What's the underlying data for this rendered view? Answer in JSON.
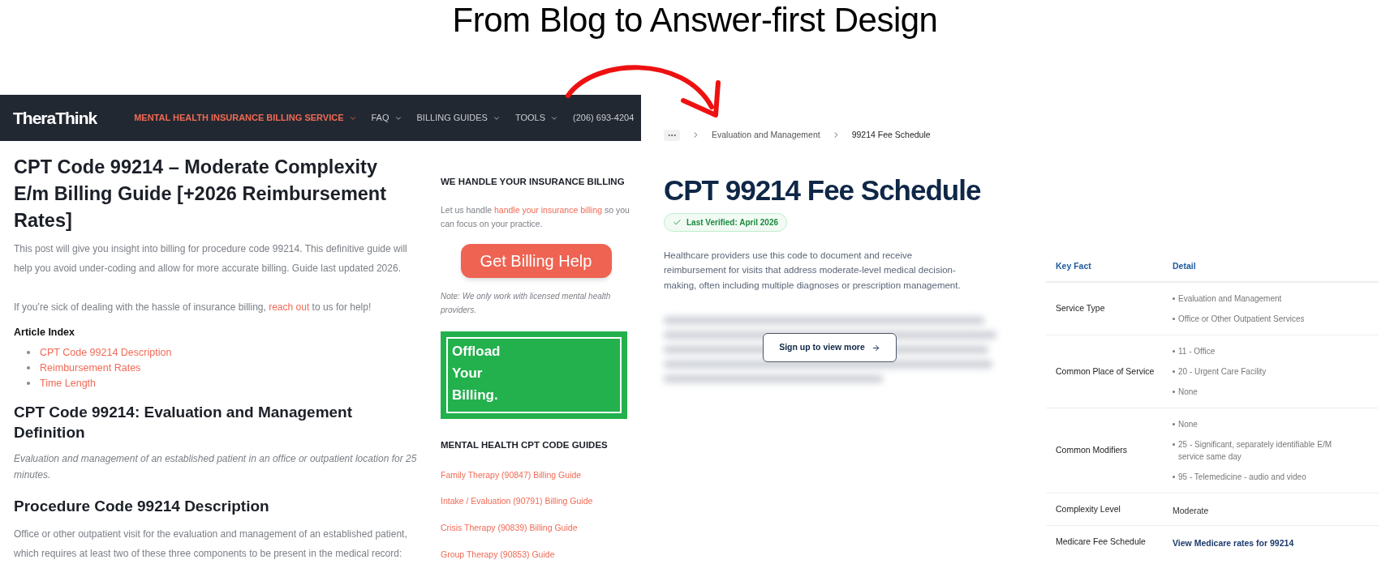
{
  "headline": "From Blog to Answer-first Design",
  "blog": {
    "logo": "TheraThink",
    "nav": [
      {
        "label": "MENTAL HEALTH INSURANCE BILLING SERVICE",
        "selected": true,
        "dropdown": true
      },
      {
        "label": "FAQ",
        "selected": false,
        "dropdown": true
      },
      {
        "label": "BILLING GUIDES",
        "selected": false,
        "dropdown": true
      },
      {
        "label": "TOOLS",
        "selected": false,
        "dropdown": true
      },
      {
        "label": "(206) 693-4204",
        "selected": false,
        "dropdown": false
      }
    ],
    "title": "CPT Code 99214 – Moderate Complexity E/m Billing Guide [+2026 Reimbursement Rates]",
    "intro": "This post will give you insight into billing for procedure code 99214. This definitive guide will help you avoid under-coding and allow for more accurate billing. Guide last updated 2026.",
    "help": {
      "before": "If you’re sick of dealing with the hassle of insurance billing,",
      "link": "reach out",
      "after": "to us for help!"
    },
    "index_title": "Article Index",
    "index": [
      "CPT Code 99214 Description",
      "Reimbursement Rates",
      "Time Length"
    ],
    "h2_definition": "CPT Code 99214: Evaluation and Management Definition",
    "definition": "Evaluation and management of an established patient in an office or outpatient location for 25 minutes.",
    "h2_description": "Procedure Code 99214 Description",
    "description": "Office or other outpatient visit for the evaluation and management of an established patient, which requires at least two of these three components to be present in the medical record:",
    "sidebar": {
      "heading": "WE HANDLE YOUR INSURANCE BILLING",
      "text": {
        "before": "Let us handle",
        "link": "handle your insurance billing",
        "after": "so you can focus on your practice."
      },
      "button": "Get Billing Help",
      "note": "Note: We only work with licensed mental health providers.",
      "banner": [
        "Offload",
        "Your",
        "Billing."
      ],
      "guides_heading": "MENTAL HEALTH CPT CODE GUIDES",
      "guides": [
        "Family Therapy (90847) Billing Guide",
        "Intake / Evaluation (90791) Billing Guide",
        "Crisis Therapy (90839) Billing Guide",
        "Group Therapy (90853) Guide"
      ]
    }
  },
  "answer": {
    "breadcrumb": [
      "Evaluation and Management",
      "99214 Fee Schedule"
    ],
    "title": "CPT 99214 Fee Schedule",
    "badge": "Last Verified: April 2026",
    "summary": "Healthcare providers use this code to document and receive reimbursement for visits that address moderate-level medical decision-making, often including multiple diagnoses or prescription management.",
    "signup": "Sign up to view more",
    "table": {
      "columns": [
        "Key Fact",
        "Detail"
      ],
      "rows": [
        {
          "kind": "list",
          "fact": "Service Type",
          "detail": [
            "Evaluation and Management",
            "Office or Other Outpatient Services"
          ]
        },
        {
          "kind": "list",
          "fact": "Common Place of Service",
          "detail": [
            "11 - Office",
            "20 - Urgent Care Facility",
            "None"
          ]
        },
        {
          "kind": "list",
          "fact": "Common Modifiers",
          "detail": [
            "None",
            "25 - Significant, separately identifiable E/M service same day",
            "95 - Telemedicine - audio and video"
          ]
        },
        {
          "kind": "text",
          "fact": "Complexity Level",
          "detail": "Moderate"
        },
        {
          "kind": "link",
          "fact": "Medicare Fee Schedule",
          "detail": "View Medicare rates for 99214"
        }
      ]
    }
  }
}
